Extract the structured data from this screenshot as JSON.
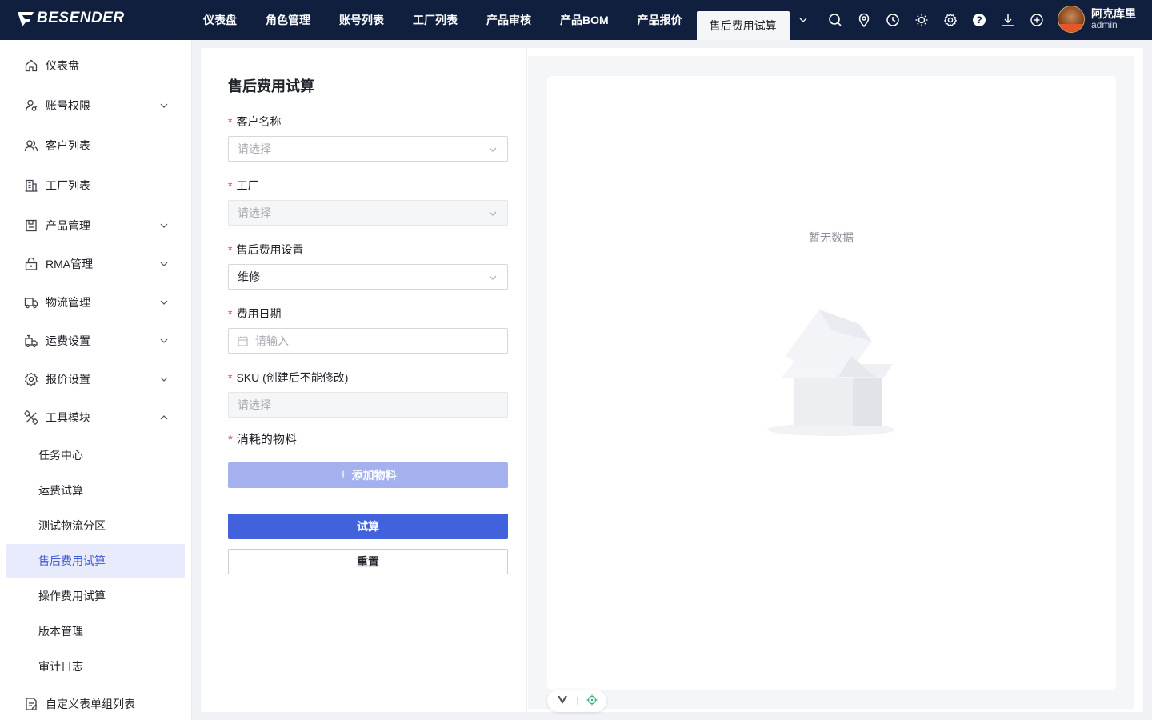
{
  "app": {
    "brand": "BESENDER"
  },
  "header": {
    "nav": [
      {
        "label": "仪表盘"
      },
      {
        "label": "角色管理"
      },
      {
        "label": "账号列表"
      },
      {
        "label": "工厂列表"
      },
      {
        "label": "产品审核"
      },
      {
        "label": "产品BOM"
      },
      {
        "label": "产品报价"
      },
      {
        "label": "售后费用试算",
        "active": true
      }
    ],
    "tools": [
      "search-icon",
      "location-icon",
      "clock-icon",
      "sun-icon",
      "gear-icon",
      "help-icon",
      "download-icon",
      "plus-circle-icon"
    ],
    "user": {
      "name": "阿克库里",
      "role": "admin"
    }
  },
  "sidebar": {
    "items": [
      {
        "label": "仪表盘",
        "icon": "home-icon"
      },
      {
        "label": "账号权限",
        "icon": "user-key-icon",
        "expandable": true
      },
      {
        "label": "客户列表",
        "icon": "users-icon"
      },
      {
        "label": "工厂列表",
        "icon": "building-icon"
      },
      {
        "label": "产品管理",
        "icon": "box-icon",
        "expandable": true
      },
      {
        "label": "RMA管理",
        "icon": "lock-bag-icon",
        "expandable": true
      },
      {
        "label": "物流管理",
        "icon": "truck-icon",
        "expandable": true
      },
      {
        "label": "运费设置",
        "icon": "shipping-icon",
        "expandable": true
      },
      {
        "label": "报价设置",
        "icon": "settings-icon",
        "expandable": true
      },
      {
        "label": "工具模块",
        "icon": "tools-icon",
        "expanded": true
      }
    ],
    "sub_items": [
      {
        "label": "任务中心"
      },
      {
        "label": "运费试算"
      },
      {
        "label": "测试物流分区"
      },
      {
        "label": "售后费用试算",
        "active": true
      },
      {
        "label": "操作费用试算"
      },
      {
        "label": "版本管理"
      },
      {
        "label": "审计日志"
      }
    ],
    "bottom_item": {
      "label": "自定义表单组列表",
      "icon": "form-icon"
    }
  },
  "form": {
    "title": "售后费用试算",
    "required_mark": "*",
    "fields": {
      "customer": {
        "label": "客户名称",
        "placeholder": "请选择"
      },
      "factory": {
        "label": "工厂",
        "placeholder": "请选择"
      },
      "fee_setting": {
        "label": "售后费用设置",
        "value": "维修"
      },
      "fee_date": {
        "label": "费用日期",
        "placeholder": "请输入"
      },
      "sku": {
        "label": "SKU (创建后不能修改)",
        "placeholder": "请选择"
      }
    },
    "materials_label": "消耗的物料",
    "add_material_label": "添加物料",
    "calculate_label": "试算",
    "reset_label": "重置"
  },
  "result": {
    "empty_text": "暂无数据"
  },
  "colors": {
    "topbar": "#0f1f3d",
    "primary": "#4262dd",
    "primary_light": "#a5b0ee",
    "required": "#e5484d",
    "active_bg": "#e8ebfb"
  }
}
